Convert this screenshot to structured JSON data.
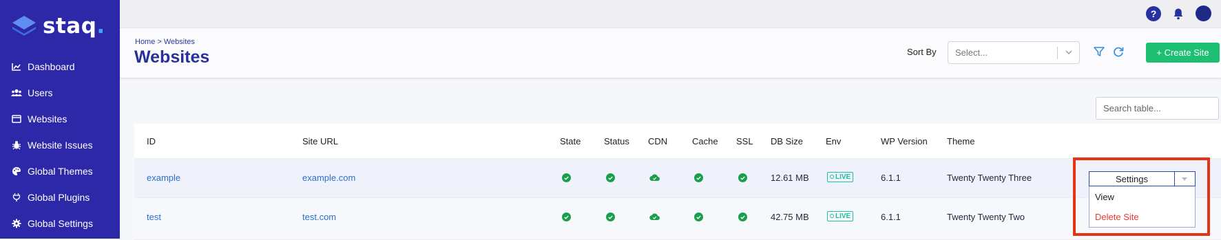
{
  "brand": {
    "name": "staq",
    "dot": ".",
    "accent": "#3ea6ff"
  },
  "sidebar": {
    "items": [
      {
        "label": "Dashboard",
        "icon": "chart-icon"
      },
      {
        "label": "Users",
        "icon": "users-icon"
      },
      {
        "label": "Websites",
        "icon": "browser-icon"
      },
      {
        "label": "Website Issues",
        "icon": "bug-icon"
      },
      {
        "label": "Global Themes",
        "icon": "palette-icon"
      },
      {
        "label": "Global Plugins",
        "icon": "plug-icon"
      },
      {
        "label": "Global Settings",
        "icon": "gear-icon"
      }
    ]
  },
  "topbar": {
    "help_label": "?",
    "icons": [
      "help-icon",
      "bell-icon",
      "avatar"
    ]
  },
  "header": {
    "breadcrumb": "Home > Websites",
    "title": "Websites",
    "sort_label": "Sort By",
    "sort_placeholder": "Select...",
    "create_button": "+ Create Site"
  },
  "table": {
    "search_placeholder": "Search table...",
    "columns": [
      "ID",
      "Site URL",
      "State",
      "Status",
      "CDN",
      "Cache",
      "SSL",
      "DB Size",
      "Env",
      "WP Version",
      "Theme"
    ],
    "rows": [
      {
        "id": "example",
        "url": "example.com",
        "db_size": "12.61 MB",
        "env": "LIVE",
        "wp_version": "6.1.1",
        "theme": "Twenty Twenty Three"
      },
      {
        "id": "test",
        "url": "test.com",
        "db_size": "42.75 MB",
        "env": "LIVE",
        "wp_version": "6.1.1",
        "theme": "Twenty Twenty Two"
      }
    ]
  },
  "actions": {
    "settings_label": "Settings",
    "menu": [
      "View",
      "Delete Site"
    ]
  },
  "colors": {
    "sidebar": "#2c28a8",
    "title": "#26319c",
    "success": "#1c9e4d",
    "create": "#1dbf73",
    "danger": "#e53935",
    "highlight": "#e53316"
  }
}
